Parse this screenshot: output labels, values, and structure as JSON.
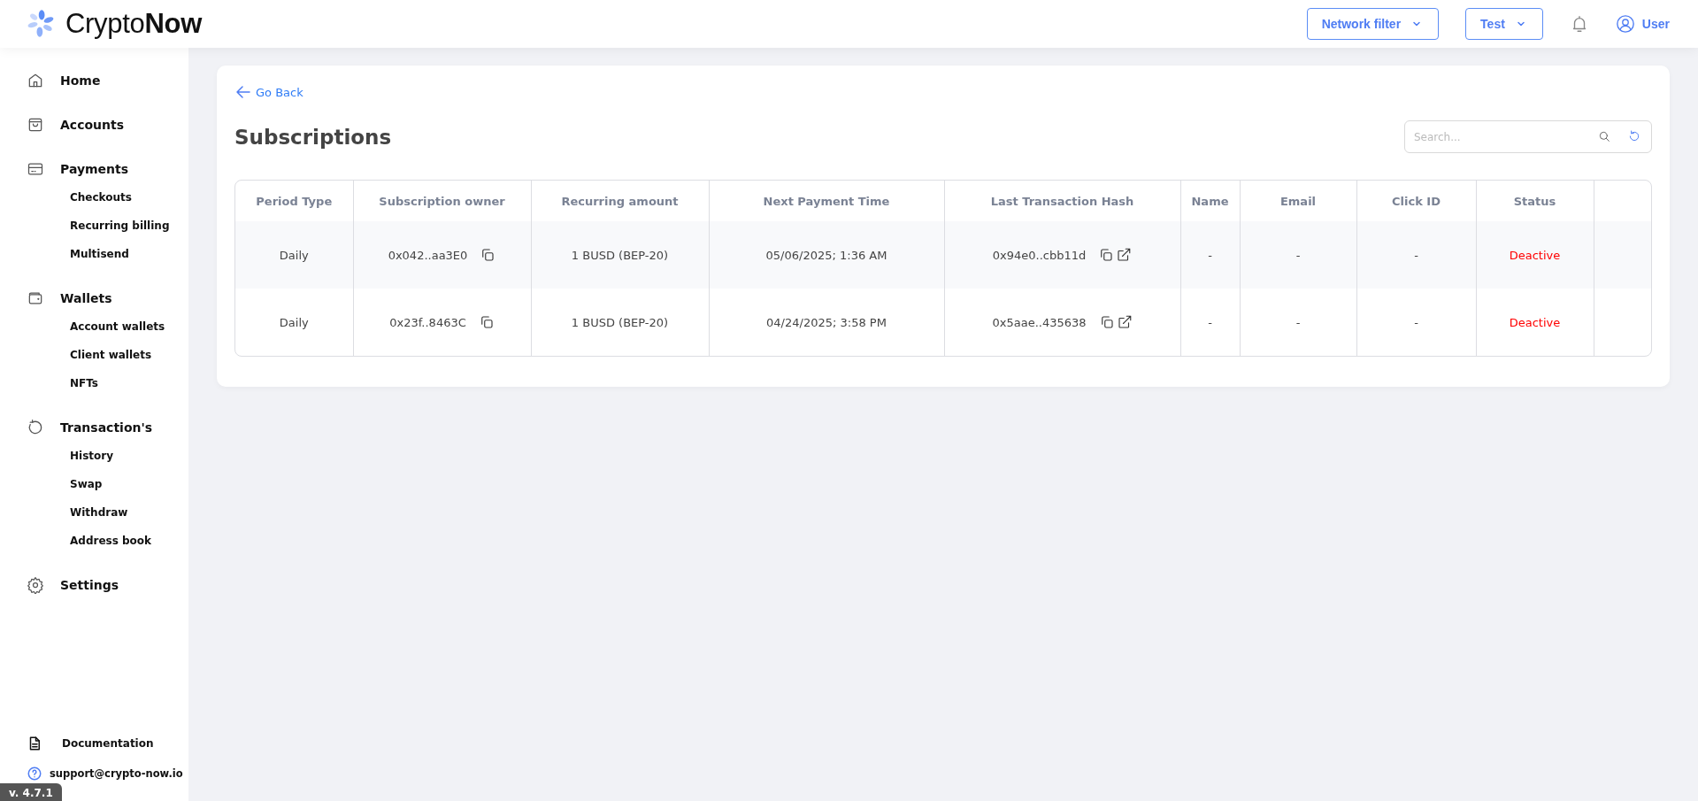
{
  "header": {
    "logo": {
      "light": "Crypto",
      "bold": "Now"
    },
    "network_filter": "Network filter",
    "project": "Test",
    "user": "User"
  },
  "sidebar": {
    "items": [
      {
        "label": "Home",
        "kind": "home"
      },
      {
        "label": "Accounts",
        "kind": "bag"
      },
      {
        "label": "Payments",
        "kind": "card",
        "children": [
          {
            "label": "Checkouts"
          },
          {
            "label": "Recurring billing"
          },
          {
            "label": "Multisend"
          }
        ]
      },
      {
        "label": "Wallets",
        "kind": "wallet",
        "children": [
          {
            "label": "Account wallets"
          },
          {
            "label": "Client wallets"
          },
          {
            "label": "NFTs"
          }
        ]
      },
      {
        "label": "Transaction's",
        "kind": "history",
        "children": [
          {
            "label": "History"
          },
          {
            "label": "Swap"
          },
          {
            "label": "Withdraw"
          },
          {
            "label": "Address book"
          }
        ]
      },
      {
        "label": "Settings",
        "kind": "gear"
      }
    ],
    "footer": [
      {
        "label": "Documentation",
        "kind": "doc"
      },
      {
        "label": "support@crypto-now.io",
        "kind": "help"
      }
    ],
    "version": "v. 4.7.1"
  },
  "page": {
    "back": "Go Back",
    "title": "Subscriptions",
    "search": {
      "placeholder": "Search..."
    }
  },
  "table": {
    "columns": [
      "Period Type",
      "Subscription owner",
      "Recurring amount",
      "Next Payment Time",
      "Last Transaction Hash",
      "Name",
      "Email",
      "Click ID",
      "Status"
    ],
    "rows": [
      {
        "period": "Daily",
        "owner": "0x042..aa3E0",
        "amount": "1 BUSD (BEP-20)",
        "next": "05/06/2025; 1:36 AM",
        "hash": "0x94e0..cbb11d",
        "name": "-",
        "email": "-",
        "click_id": "-",
        "status": "Deactive",
        "kind": "inactive"
      },
      {
        "period": "Daily",
        "owner": "0x23f..8463C",
        "amount": "1 BUSD (BEP-20)",
        "next": "04/24/2025; 3:58 PM",
        "hash": "0x5aae..435638",
        "name": "-",
        "email": "-",
        "click_id": "-",
        "status": "Deactive",
        "kind": "inactive"
      }
    ]
  }
}
